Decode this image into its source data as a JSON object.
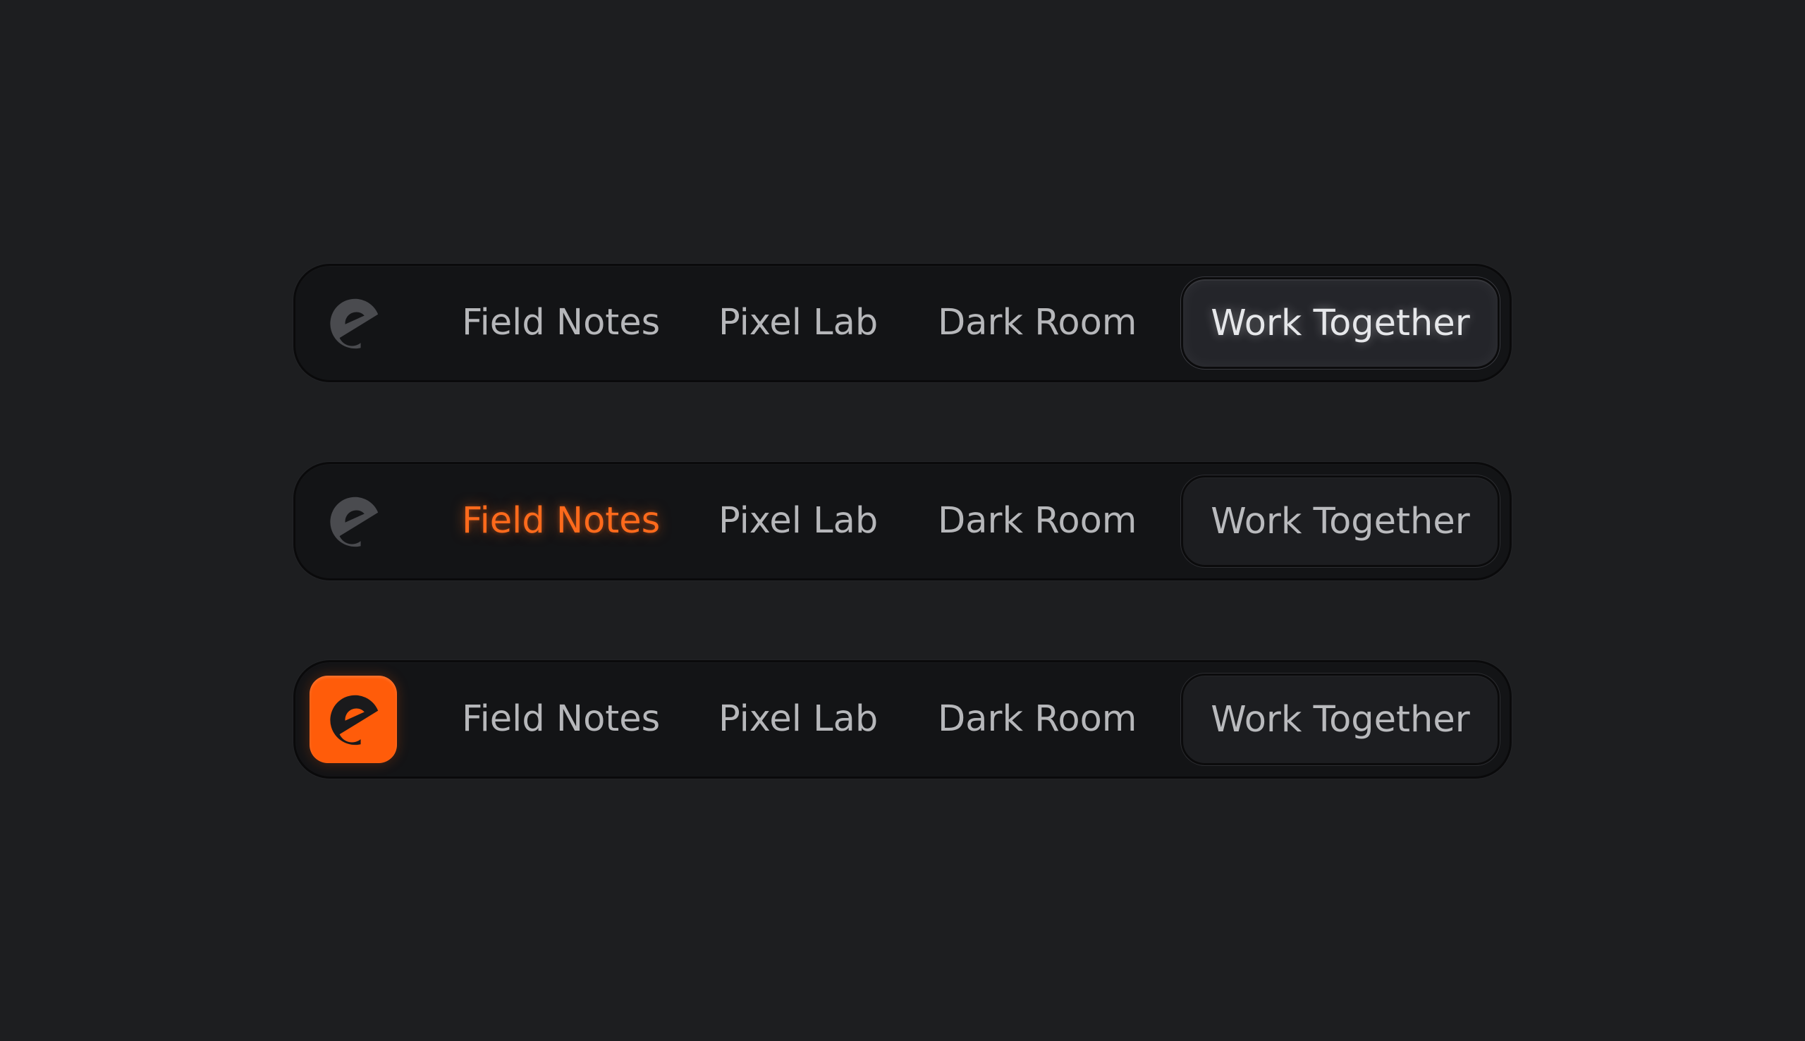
{
  "colors": {
    "background": "#1d1e20",
    "bar": "#131416",
    "accent": "#ff5c0a",
    "text": "#b6b7ba"
  },
  "navbars": [
    {
      "logo_icon": "e-logo-icon",
      "logo_active": false,
      "links": [
        "Field Notes",
        "Pixel Lab",
        "Dark Room"
      ],
      "highlighted_link": null,
      "cta_label": "Work Together",
      "cta_state": "hover"
    },
    {
      "logo_icon": "e-logo-icon",
      "logo_active": false,
      "links": [
        "Field Notes",
        "Pixel Lab",
        "Dark Room"
      ],
      "highlighted_link": "Field Notes",
      "cta_label": "Work Together",
      "cta_state": "default"
    },
    {
      "logo_icon": "e-logo-icon",
      "logo_active": true,
      "links": [
        "Field Notes",
        "Pixel Lab",
        "Dark Room"
      ],
      "highlighted_link": null,
      "cta_label": "Work Together",
      "cta_state": "default"
    }
  ]
}
